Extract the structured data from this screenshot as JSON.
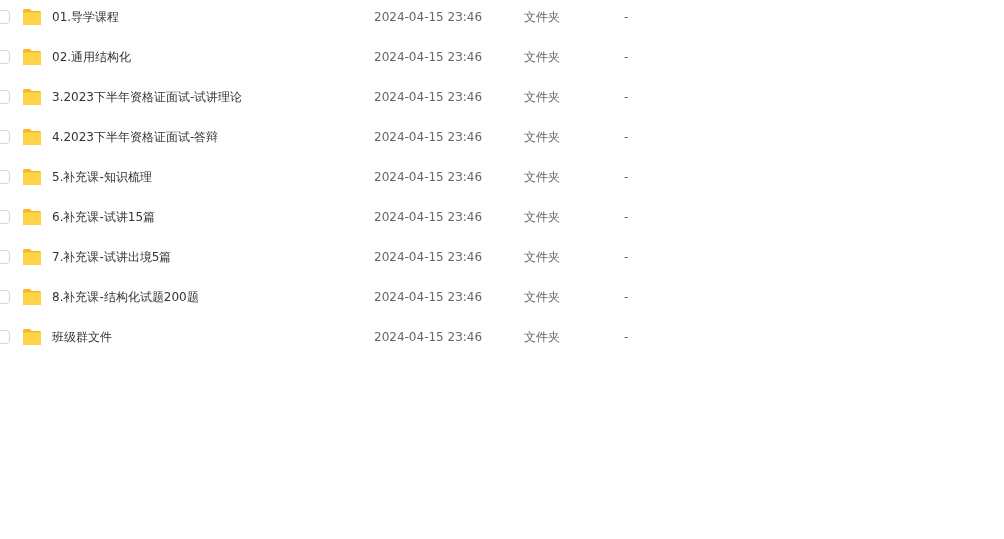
{
  "files": [
    {
      "name": "01.导学课程",
      "modified": "2024-04-15 23:46",
      "type": "文件夹",
      "size": "-",
      "checked": false
    },
    {
      "name": "02.通用结构化",
      "modified": "2024-04-15 23:46",
      "type": "文件夹",
      "size": "-",
      "checked": false
    },
    {
      "name": "3.2023下半年资格证面试-试讲理论",
      "modified": "2024-04-15 23:46",
      "type": "文件夹",
      "size": "-",
      "checked": false
    },
    {
      "name": "4.2023下半年资格证面试-答辩",
      "modified": "2024-04-15 23:46",
      "type": "文件夹",
      "size": "-",
      "checked": false
    },
    {
      "name": "5.补充课-知识梳理",
      "modified": "2024-04-15 23:46",
      "type": "文件夹",
      "size": "-",
      "checked": false
    },
    {
      "name": "6.补充课-试讲15篇",
      "modified": "2024-04-15 23:46",
      "type": "文件夹",
      "size": "-",
      "checked": false
    },
    {
      "name": "7.补充课-试讲出境5篇",
      "modified": "2024-04-15 23:46",
      "type": "文件夹",
      "size": "-",
      "checked": false
    },
    {
      "name": "8.补充课-结构化试题200题",
      "modified": "2024-04-15 23:46",
      "type": "文件夹",
      "size": "-",
      "checked": false
    },
    {
      "name": "班级群文件",
      "modified": "2024-04-15 23:46",
      "type": "文件夹",
      "size": "-",
      "checked": false
    }
  ]
}
